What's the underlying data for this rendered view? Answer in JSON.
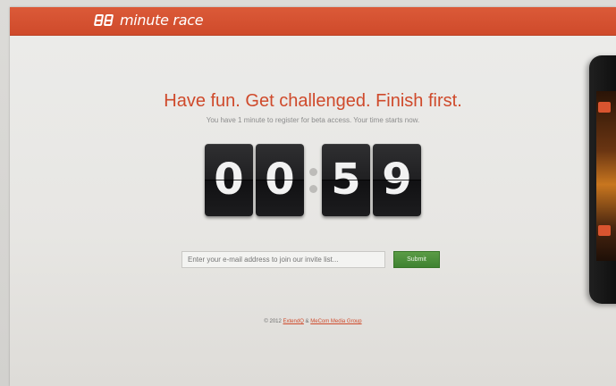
{
  "brand": {
    "logo_mark": "88",
    "name": "minute race",
    "accent_color": "#cf4a2b"
  },
  "hero": {
    "headline": "Have fun. Get challenged. Finish first.",
    "subline": "You have 1 minute to register for beta access. Your time starts now."
  },
  "timer": {
    "minutes": [
      "0",
      "0"
    ],
    "seconds": [
      "5",
      "9"
    ]
  },
  "signup": {
    "email_placeholder": "Enter your e-mail address to join our invite list...",
    "submit_label": "Submit"
  },
  "footer": {
    "copyright": "© 2012",
    "link1": "ExtendQ",
    "ampersand": "&",
    "link2": "MeCom Media Group"
  }
}
